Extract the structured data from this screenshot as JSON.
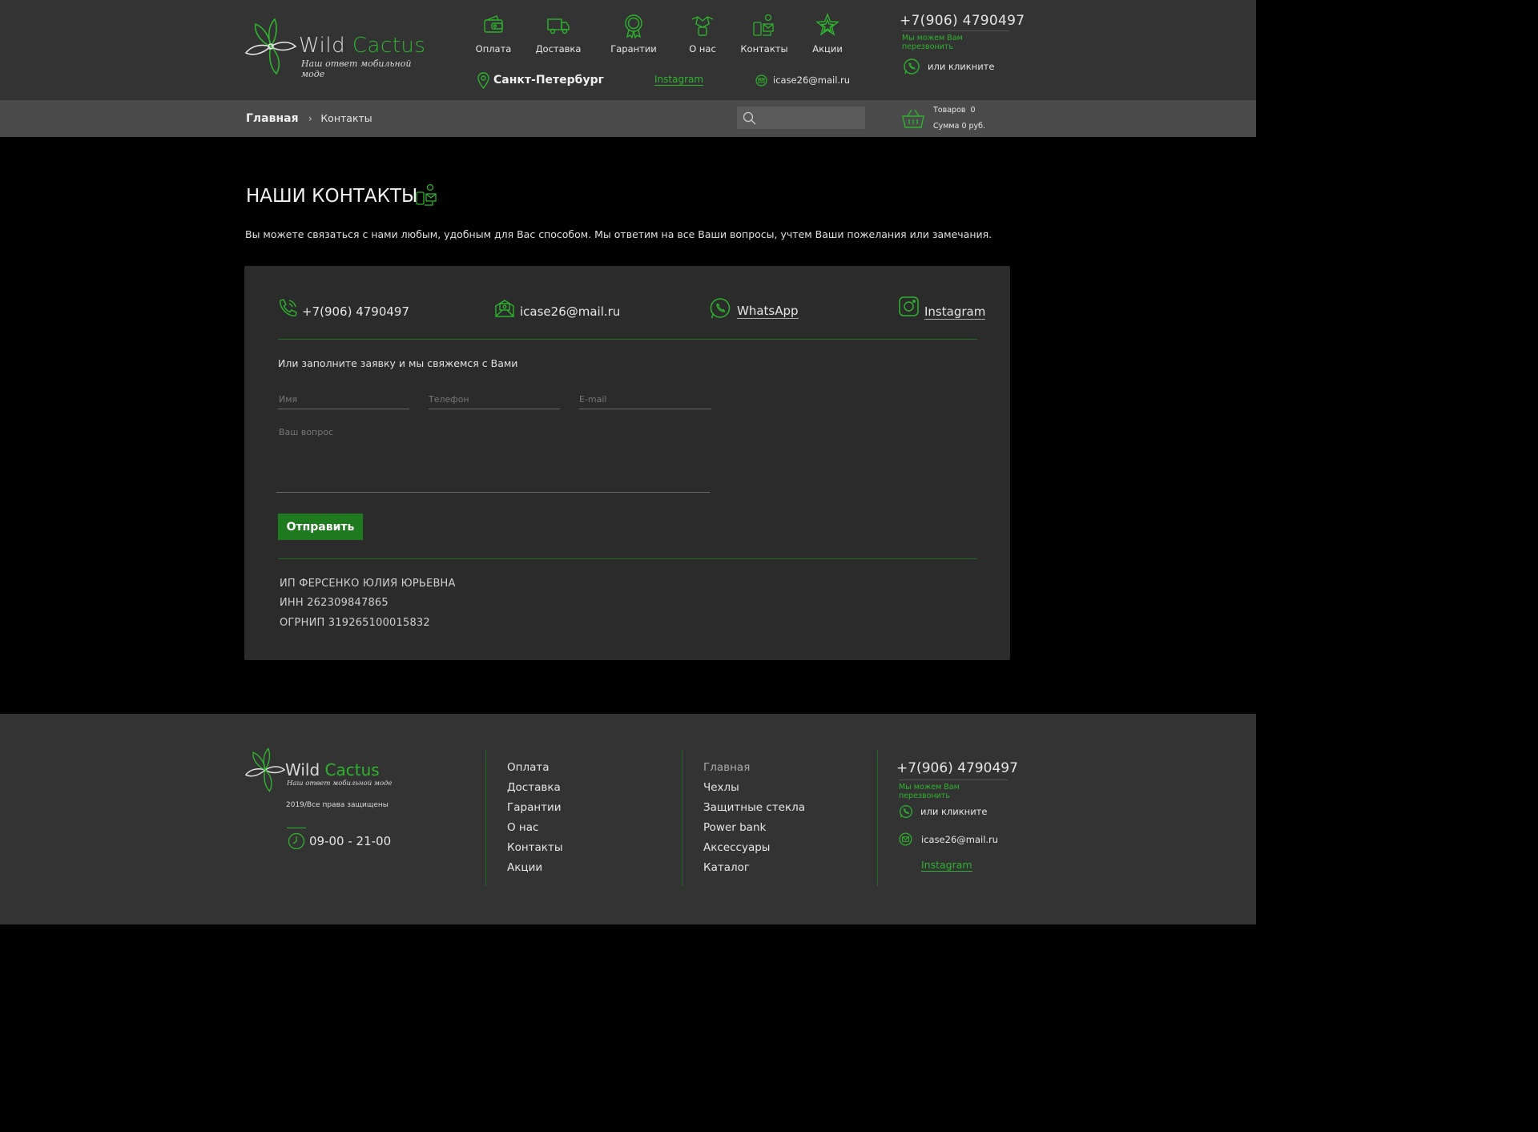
{
  "brand": {
    "name_part1": "Wild",
    "name_part2": "Cactus",
    "tagline": "Наш ответ мобильной моде",
    "accent": "#2db32d"
  },
  "header": {
    "nav": [
      {
        "label": "Оплата",
        "icon": "wallet-icon"
      },
      {
        "label": "Доставка",
        "icon": "truck-icon"
      },
      {
        "label": "Гарантии",
        "icon": "badge-icon"
      },
      {
        "label": "О нас",
        "icon": "handshake-icon"
      },
      {
        "label": "Контакты",
        "icon": "contacts-icon"
      },
      {
        "label": "Акции",
        "icon": "star-icon"
      }
    ],
    "city": "Санкт-Петербург",
    "instagram": "Instagram",
    "email": "icase26@mail.ru",
    "phone": "+7(906) 4790497",
    "callback": "Мы можем Вам перезвонить",
    "click_text": "или кликните"
  },
  "breadcrumb": {
    "home": "Главная",
    "current": "Контакты"
  },
  "cart": {
    "items_label": "Товаров",
    "items_count": "0",
    "sum_label": "Сумма",
    "sum_value": "0 руб."
  },
  "main": {
    "title": "НАШИ КОНТАКТЫ",
    "intro": "Вы можете связаться с нами любым, удобным для Вас способом. Мы ответим на все Ваши вопросы, учтем Ваши  пожелания или замечания.",
    "contacts": {
      "phone": "+7(906) 4790497",
      "email": "icase26@mail.ru",
      "whatsapp": "WhatsApp",
      "instagram": "Instagram"
    },
    "form": {
      "heading": "Или заполните заявку и мы свяжемся с Вами",
      "name_placeholder": "Имя",
      "phone_placeholder": "Телефон",
      "email_placeholder": "E-mail",
      "question_placeholder": "Ваш вопрос",
      "submit": "Отправить"
    },
    "legal": {
      "owner": "ИП ФЕРСЕНКО ЮЛИЯ ЮРЬЕВНА",
      "inn": "ИНН 262309847865",
      "ogrnip": "ОГРНИП 319265100015832"
    }
  },
  "footer": {
    "copyright": "2019/Все права защищены",
    "hours": "09-00 - 21-00",
    "col1": [
      "Оплата",
      "Доставка",
      "Гарантии",
      "О нас",
      "Контакты",
      "Акции"
    ],
    "col2": [
      "Главная",
      "Чехлы",
      "Защитные стекла",
      "Power bank",
      "Аксессуары",
      "Каталог"
    ],
    "phone": "+7(906) 4790497",
    "callback": "Мы можем Вам перезвонить",
    "click_text": "или кликните",
    "email": "icase26@mail.ru",
    "instagram": "Instagram"
  }
}
